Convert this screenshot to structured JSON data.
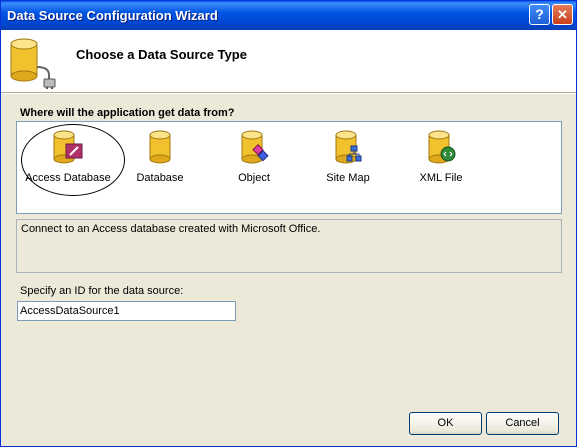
{
  "window": {
    "title": "Data Source Configuration Wizard",
    "help_button": "?",
    "close_button": "✕"
  },
  "header": {
    "title": "Choose a Data Source Type"
  },
  "question": "Where will the application get data from?",
  "types": [
    {
      "label": "Access Database",
      "icon": "access-database-icon",
      "selected": true
    },
    {
      "label": "Database",
      "icon": "database-icon"
    },
    {
      "label": "Object",
      "icon": "object-icon"
    },
    {
      "label": "Site Map",
      "icon": "site-map-icon"
    },
    {
      "label": "XML File",
      "icon": "xml-file-icon"
    }
  ],
  "description": "Connect to an Access database created with Microsoft Office.",
  "id_label": "Specify an ID for the data source:",
  "id_value": "AccessDataSource1",
  "buttons": {
    "ok": "OK",
    "cancel": "Cancel"
  },
  "colors": {
    "titlebar": "#0054e3",
    "dialog_bg": "#ece9d8",
    "cylinder_gold": "#f2c12e"
  }
}
